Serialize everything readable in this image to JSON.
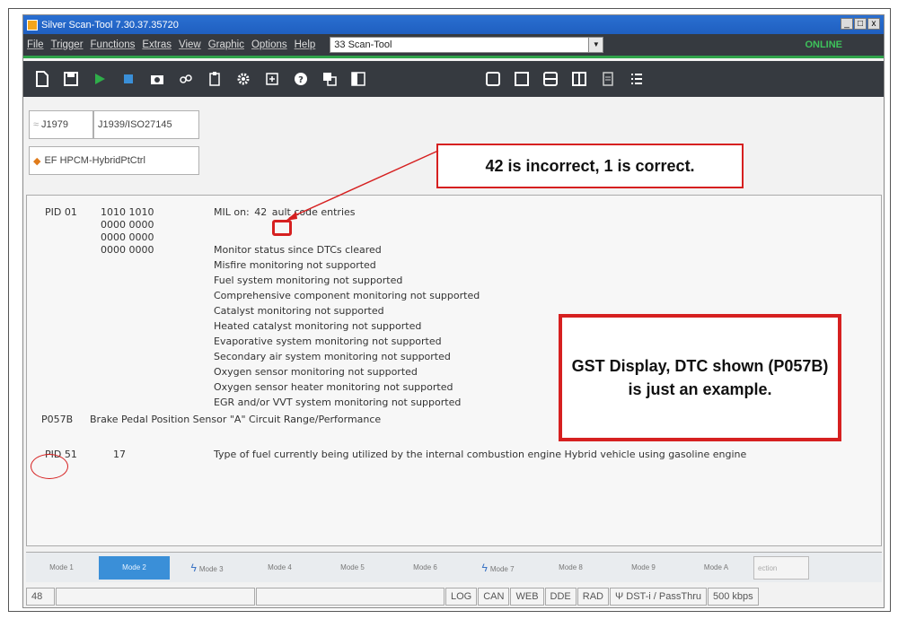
{
  "window": {
    "title": "Silver Scan-Tool 7.30.37.35720",
    "controls": [
      "_",
      "□",
      "x"
    ]
  },
  "menu": {
    "items": [
      "File",
      "Trigger",
      "Functions",
      "Extras",
      "View",
      "Graphic",
      "Options",
      "Help"
    ],
    "combo_value": "33  Scan-Tool",
    "status": "ONLINE"
  },
  "toolbar": {
    "icons": [
      "new-icon",
      "save-icon",
      "play-icon",
      "stop-icon",
      "camera-icon",
      "link-icon",
      "clipboard-icon",
      "gear-icon",
      "import-icon",
      "help-icon",
      "copy-icon",
      "panel-icon",
      "layout-1-icon",
      "layout-2-icon",
      "layout-3-icon",
      "layout-4-icon",
      "report-icon",
      "list-icon"
    ]
  },
  "tabs": {
    "j1979": "J1979",
    "j1939": "J1939/ISO27145",
    "ecu": "EF  HPCM-HybridPtCtrl"
  },
  "content": {
    "pid01_label": "PID 01",
    "pid01_bytes": [
      "1010 1010",
      "0000 0000",
      "0000 0000",
      "0000 0000"
    ],
    "mil_prefix": "MIL on:",
    "mil_value": "42",
    "mil_suffix": "ault code entries",
    "monitor_lines": [
      "Monitor status since DTCs cleared",
      "Misfire monitoring not supported",
      "Fuel system monitoring not supported",
      "Comprehensive component monitoring not supported",
      "Catalyst monitoring not supported",
      "Heated catalyst monitoring not supported",
      "Evaporative system monitoring not supported",
      "Secondary air system monitoring not supported",
      "Oxygen sensor monitoring not supported",
      "Oxygen sensor heater monitoring not supported",
      "EGR and/or VVT system monitoring not supported"
    ],
    "dtc_code": "P057B",
    "dtc_description": "Brake Pedal Position Sensor \"A\" Circuit Range/Performance",
    "pid51_label": "PID 51",
    "pid51_value": "17",
    "pid51_description": "Type of fuel currently being utilized by the internal combustion engine Hybrid vehicle using gasoline engine"
  },
  "modes": [
    {
      "label": "Mode 1",
      "active": false,
      "bolt": false
    },
    {
      "label": "Mode 2",
      "active": true,
      "bolt": false
    },
    {
      "label": "Mode 3",
      "active": false,
      "bolt": true
    },
    {
      "label": "Mode 4",
      "active": false,
      "bolt": false
    },
    {
      "label": "Mode 5",
      "active": false,
      "bolt": false
    },
    {
      "label": "Mode 6",
      "active": false,
      "bolt": false
    },
    {
      "label": "Mode 7",
      "active": false,
      "bolt": true
    },
    {
      "label": "Mode 8",
      "active": false,
      "bolt": false
    },
    {
      "label": "Mode 9",
      "active": false,
      "bolt": false
    },
    {
      "label": "Mode A",
      "active": false,
      "bolt": false
    },
    {
      "label": "ection",
      "active": false,
      "bolt": false
    }
  ],
  "statusbar": {
    "count": "48",
    "items": [
      "LOG",
      "CAN",
      "WEB",
      "DDE",
      "RAD",
      "DST-i / PassThru",
      "500 kbps"
    ]
  },
  "annotations": {
    "callout_top": "42 is incorrect, 1 is correct.",
    "callout_box": "GST Display, DTC shown (P057B) is just an example.",
    "accent_color": "#d62020"
  }
}
